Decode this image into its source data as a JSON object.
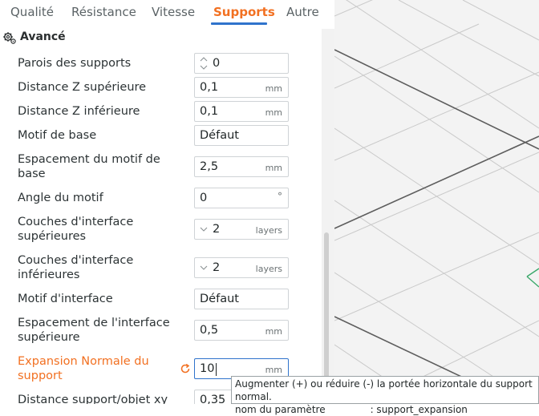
{
  "tabs": [
    {
      "label": "Qualité",
      "active": false
    },
    {
      "label": "Résistance",
      "active": false
    },
    {
      "label": "Vitesse",
      "active": false
    },
    {
      "label": "Supports",
      "active": true
    },
    {
      "label": "Autre",
      "active": false
    }
  ],
  "section": {
    "title": "Avancé",
    "icon": "gear-settings-icon"
  },
  "rows": [
    {
      "label": "Parois des supports",
      "value": "0",
      "unit": "",
      "control": "spinner"
    },
    {
      "label": "Distance Z supérieure",
      "value": "0,1",
      "unit": "mm"
    },
    {
      "label": "Distance Z inférieure",
      "value": "0,1",
      "unit": "mm"
    },
    {
      "label": "Motif de base",
      "value": "Défaut",
      "unit": ""
    },
    {
      "label": "Espacement du motif de base",
      "value": "2,5",
      "unit": "mm"
    },
    {
      "label": "Angle du motif",
      "value": "0",
      "unit": "°"
    },
    {
      "label": "Couches d'interface supérieures",
      "value": "2",
      "unit": "layers",
      "control": "dropdown"
    },
    {
      "label": "Couches d'interface inférieures",
      "value": "2",
      "unit": "layers",
      "control": "dropdown"
    },
    {
      "label": "Motif d'interface",
      "value": "Défaut",
      "unit": ""
    },
    {
      "label": "Espacement de l'interface supérieure",
      "value": "0,5",
      "unit": "mm"
    },
    {
      "label": "Expansion Normale du support",
      "value": "10",
      "unit": "mm",
      "modified": true,
      "focused": true
    },
    {
      "label": "Distance support/objet xy",
      "value": "0,35",
      "unit": ""
    }
  ],
  "tooltip": {
    "line1": "Augmenter (+) ou réduire (-) la portée horizontale du support normal.",
    "line2_label": "nom du paramètre",
    "line2_value": ": support_expansion"
  },
  "colors": {
    "accent": "#f27021",
    "focus": "#2f73cc",
    "viewport_bg": "#f3f3f3",
    "model_outline": "#3aa86a"
  }
}
